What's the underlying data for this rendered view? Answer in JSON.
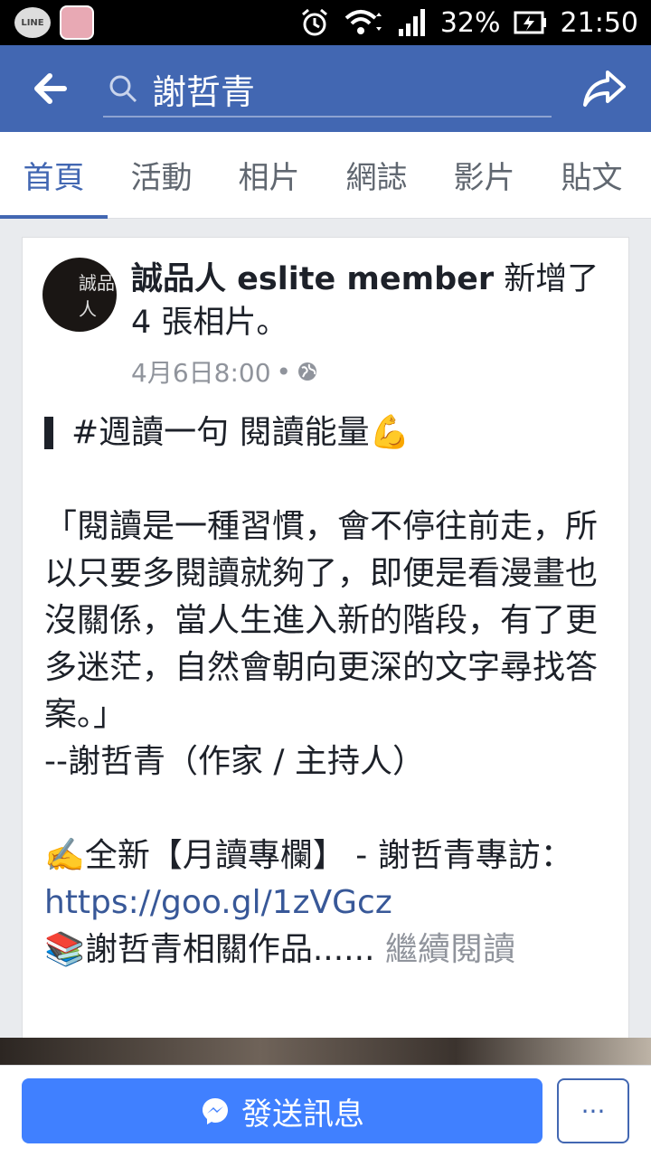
{
  "status_bar": {
    "line_label": "LINE",
    "battery": "32%",
    "time": "21:50"
  },
  "top_bar": {
    "search_text": "謝哲青"
  },
  "tabs": [
    {
      "label": "首頁",
      "active": true
    },
    {
      "label": "活動",
      "active": false
    },
    {
      "label": "相片",
      "active": false
    },
    {
      "label": "網誌",
      "active": false
    },
    {
      "label": "影片",
      "active": false
    },
    {
      "label": "貼文",
      "active": false
    }
  ],
  "post": {
    "avatar_text": "誠品人",
    "author": "誠品人 eslite member",
    "action": " 新增了 4 張相片。",
    "timestamp": "4月6日8:00",
    "separator": "•",
    "heading": "#週讀一句 閱讀能量💪",
    "quote": "「閱讀是一種習慣，會不停往前走，所以只要多閱讀就夠了，即便是看漫畫也沒關係，當人生進入新的階段，有了更多迷茫，自然會朝向更深的文字尋找答案。」",
    "attribution": "--謝哲青（作家 / 主持人）",
    "line_feature": "✍️全新【月讀專欄】 - 謝哲青專訪：",
    "link": "https://goo.gl/1zVGcz",
    "line_works": "📚謝哲青相關作品......",
    "more": "繼續閱讀"
  },
  "bottom_bar": {
    "send_label": "發送訊息",
    "more_label": "···"
  },
  "colors": {
    "brand": "#4267b2",
    "button": "#4080ff"
  },
  "icons": [
    "back-icon",
    "search-icon",
    "share-icon",
    "globe-icon",
    "messenger-icon",
    "alarm-icon",
    "wifi-icon",
    "signal-icon",
    "battery-icon"
  ]
}
